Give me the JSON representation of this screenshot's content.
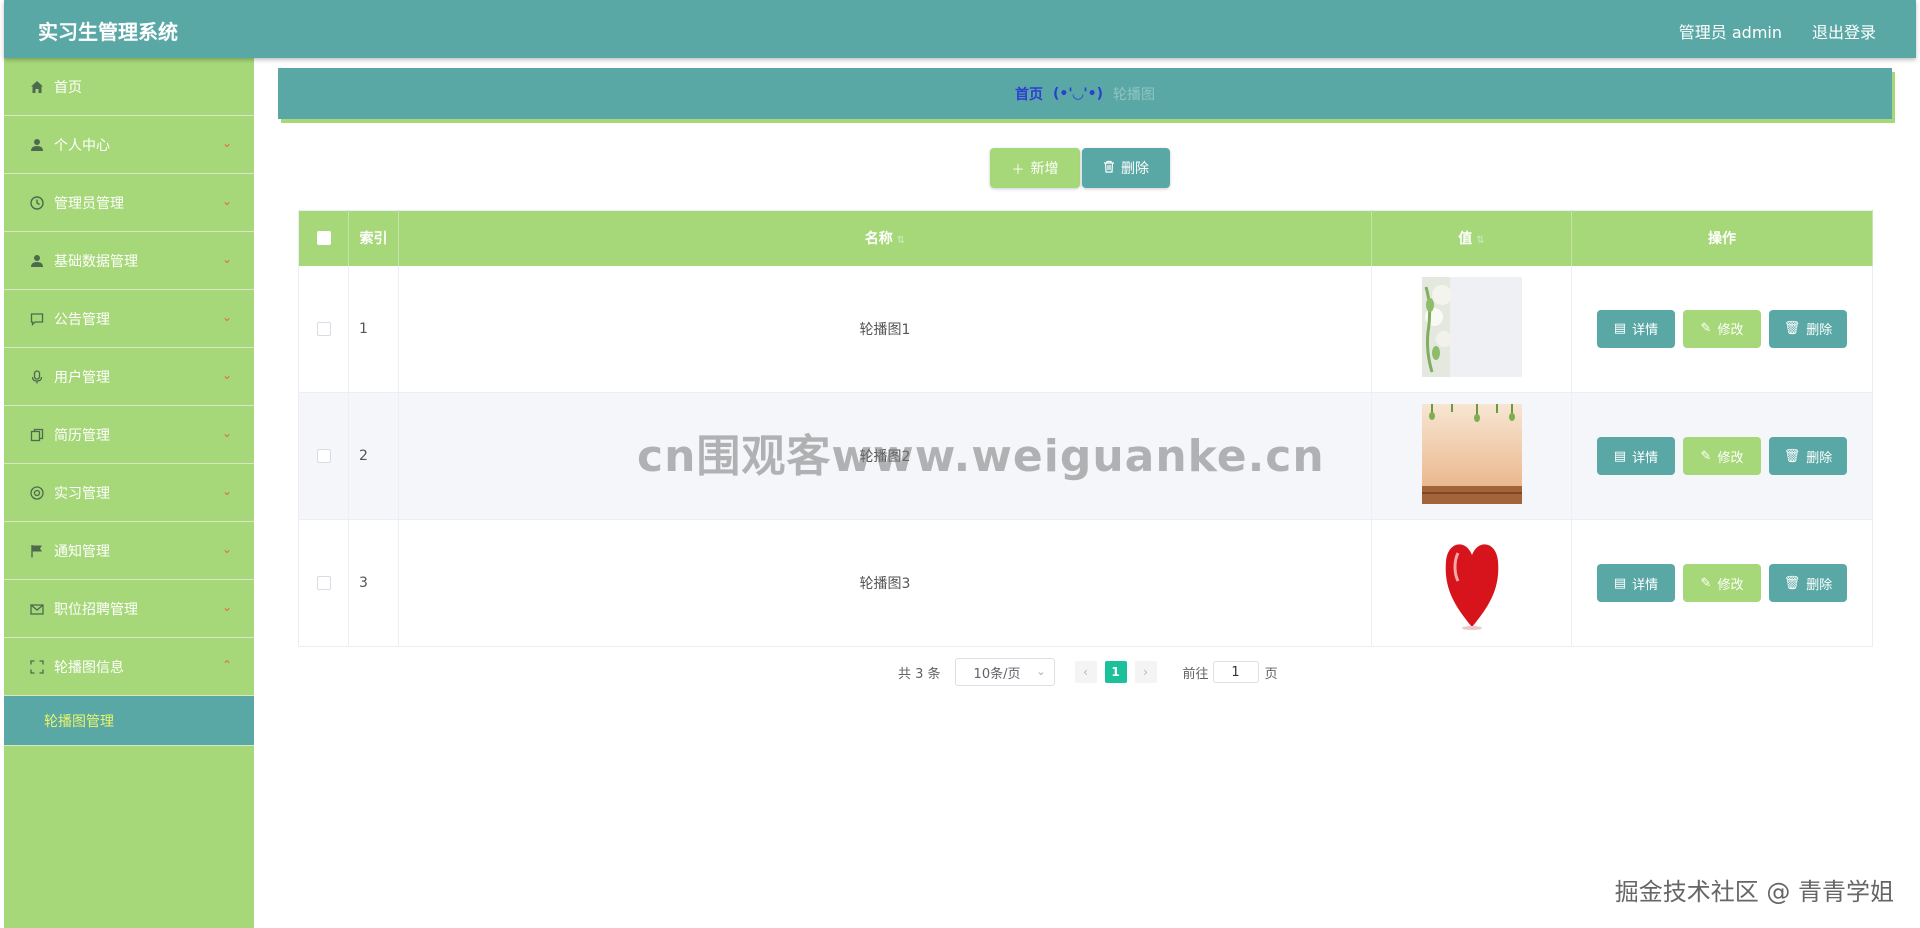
{
  "header": {
    "app_title": "实习生管理系统",
    "user_label": "管理员 admin",
    "logout_label": "退出登录"
  },
  "sidebar": {
    "items": [
      {
        "label": "首页",
        "icon": "home-icon",
        "has_arrow": false
      },
      {
        "label": "个人中心",
        "icon": "user-icon",
        "has_arrow": true
      },
      {
        "label": "管理员管理",
        "icon": "clock-icon",
        "has_arrow": true
      },
      {
        "label": "基础数据管理",
        "icon": "user-icon",
        "has_arrow": true
      },
      {
        "label": "公告管理",
        "icon": "chat-icon",
        "has_arrow": true
      },
      {
        "label": "用户管理",
        "icon": "microphone-icon",
        "has_arrow": true
      },
      {
        "label": "简历管理",
        "icon": "copy-icon",
        "has_arrow": true
      },
      {
        "label": "实习管理",
        "icon": "target-icon",
        "has_arrow": true
      },
      {
        "label": "通知管理",
        "icon": "flag-icon",
        "has_arrow": true
      },
      {
        "label": "职位招聘管理",
        "icon": "mail-icon",
        "has_arrow": true
      },
      {
        "label": "轮播图信息",
        "icon": "fullscreen-icon",
        "has_arrow": true,
        "expanded": true
      }
    ],
    "submenu": {
      "label": "轮播图管理"
    }
  },
  "breadcrumb": {
    "home": "首页",
    "face": "(•'◡'•)",
    "current": "轮播图"
  },
  "toolbar": {
    "add_label": "新增",
    "delete_label": "删除"
  },
  "table": {
    "headers": {
      "index": "索引",
      "name": "名称",
      "value": "值",
      "actions": "操作"
    },
    "rows": [
      {
        "index": "1",
        "name": "轮播图1",
        "image": "white-flowers"
      },
      {
        "index": "2",
        "name": "轮播图2",
        "image": "peach-wall-wood"
      },
      {
        "index": "3",
        "name": "轮播图3",
        "image": "red-heart"
      }
    ],
    "row_buttons": {
      "detail": "详情",
      "edit": "修改",
      "delete": "删除"
    }
  },
  "pagination": {
    "total": "共 3 条",
    "page_size": "10条/页",
    "current_page": "1",
    "goto_label": "前往",
    "goto_value": "1",
    "page_suffix": "页"
  },
  "watermarks": {
    "center": "cn围观客www.weiguanke.cn",
    "corner": "掘金技术社区 @ 青青学姐"
  },
  "colors": {
    "teal": "#5aa8a6",
    "green": "#a6d879",
    "active_page": "#1cc09a"
  }
}
